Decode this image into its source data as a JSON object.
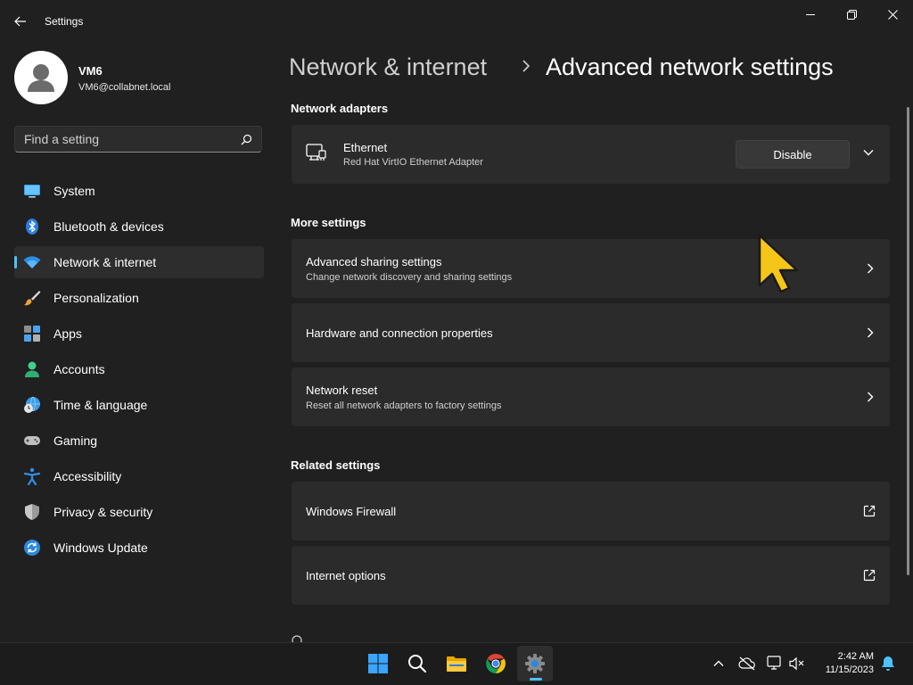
{
  "window": {
    "title": "Settings",
    "back_icon": "back-arrow-icon",
    "minimize_icon": "minimize-icon",
    "restore_icon": "restore-icon",
    "close_icon": "close-icon"
  },
  "profile": {
    "name": "VM6",
    "email": "VM6@collabnet.local",
    "avatar_icon": "user-avatar-icon"
  },
  "search": {
    "placeholder": "Find a setting",
    "value": "",
    "icon": "search-icon"
  },
  "sidebar": {
    "items": [
      {
        "label": "System",
        "icon": "system-display-icon",
        "active": false
      },
      {
        "label": "Bluetooth & devices",
        "icon": "bluetooth-icon",
        "active": false
      },
      {
        "label": "Network & internet",
        "icon": "wifi-icon",
        "active": true
      },
      {
        "label": "Personalization",
        "icon": "paintbrush-icon",
        "active": false
      },
      {
        "label": "Apps",
        "icon": "apps-icon",
        "active": false
      },
      {
        "label": "Accounts",
        "icon": "person-icon",
        "active": false
      },
      {
        "label": "Time & language",
        "icon": "globe-clock-icon",
        "active": false
      },
      {
        "label": "Gaming",
        "icon": "gamepad-icon",
        "active": false
      },
      {
        "label": "Accessibility",
        "icon": "accessibility-icon",
        "active": false
      },
      {
        "label": "Privacy & security",
        "icon": "shield-icon",
        "active": false
      },
      {
        "label": "Windows Update",
        "icon": "update-icon",
        "active": false
      }
    ]
  },
  "breadcrumb": {
    "parent": "Network & internet",
    "current": "Advanced network settings",
    "separator_icon": "chevron-right-icon"
  },
  "sections": {
    "adapters": {
      "header": "Network adapters",
      "items": [
        {
          "title": "Ethernet",
          "subtitle": "Red Hat VirtIO Ethernet Adapter",
          "icon": "ethernet-icon",
          "button": "Disable",
          "expand_icon": "chevron-down-icon"
        }
      ]
    },
    "more": {
      "header": "More settings",
      "items": [
        {
          "title": "Advanced sharing settings",
          "subtitle": "Change network discovery and sharing settings",
          "icon": "chevron-right-icon"
        },
        {
          "title": "Hardware and connection properties",
          "subtitle": "",
          "icon": "chevron-right-icon"
        },
        {
          "title": "Network reset",
          "subtitle": "Reset all network adapters to factory settings",
          "icon": "chevron-right-icon"
        }
      ]
    },
    "related": {
      "header": "Related settings",
      "items": [
        {
          "title": "Windows Firewall",
          "icon": "external-link-icon"
        },
        {
          "title": "Internet options",
          "icon": "external-link-icon"
        }
      ]
    }
  },
  "taskbar": {
    "apps": [
      {
        "name": "Start",
        "icon": "windows-start-icon"
      },
      {
        "name": "Search",
        "icon": "search-icon"
      },
      {
        "name": "File Explorer",
        "icon": "folder-icon"
      },
      {
        "name": "Chrome",
        "icon": "chrome-icon"
      },
      {
        "name": "Settings",
        "icon": "gear-icon",
        "active": true
      }
    ],
    "tray": [
      "chevron-up-icon",
      "cloud-offline-icon",
      "network-icon",
      "volume-muted-icon",
      "notification-bell-icon"
    ],
    "time": "2:42 AM",
    "date": "11/15/2023"
  },
  "colors": {
    "background": "#202020",
    "card": "#2b2b2b",
    "accent": "#4cc2ff",
    "cursor": "#f5c518"
  }
}
